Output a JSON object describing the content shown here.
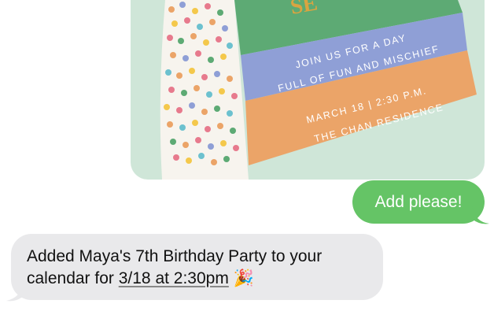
{
  "invitation": {
    "title_fragment": "SE",
    "line1": "JOIN US FOR A DAY",
    "line2": "FULL OF FUN AND MISCHIEF",
    "line3": "MARCH 18 | 2:30 P.M.",
    "line4": "THE CHAN RESIDENCE"
  },
  "messages": {
    "outgoing_text": "Add please!",
    "incoming_text_before": "Added Maya's 7th Birthday Party to your calendar for ",
    "incoming_date_link": "3/18 at 2:30pm",
    "incoming_emoji": "🎉"
  },
  "colors": {
    "outgoing_bubble": "#65c466",
    "incoming_bubble": "#e9e9eb",
    "invite_background": "#cfe6d8",
    "band_green": "#5daa74",
    "band_blue": "#8f9fd6",
    "band_orange": "#eba468",
    "title_gold": "#d9a441"
  }
}
